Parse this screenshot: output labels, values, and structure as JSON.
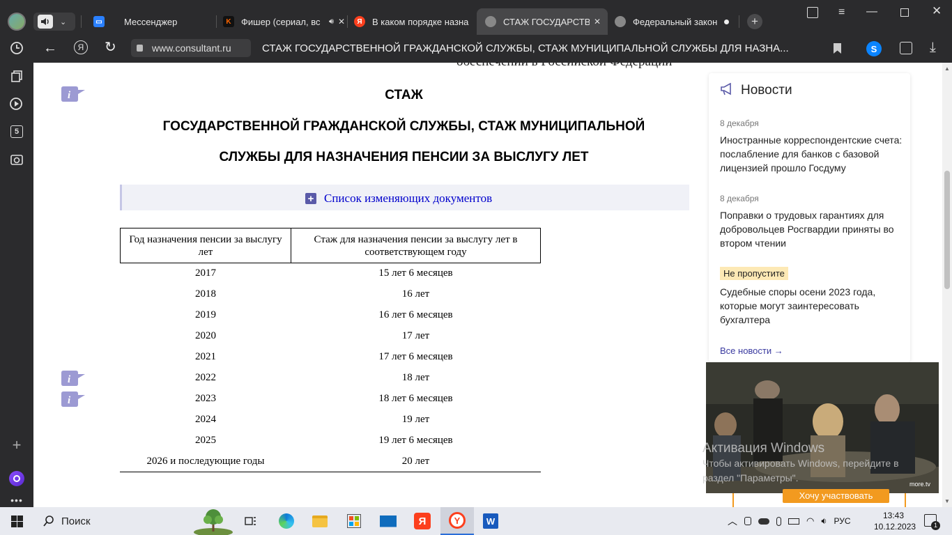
{
  "browser": {
    "tabs": [
      {
        "label": "Мессенджер"
      },
      {
        "label": "Фишер (сериал, вс"
      },
      {
        "label": "В каком порядке назна"
      },
      {
        "label": "СТАЖ ГОСУДАРСТВЕН"
      },
      {
        "label": "Федеральный закон"
      }
    ],
    "url_domain": "www.consultant.ru",
    "page_title": "СТАЖ ГОСУДАРСТВЕННОЙ ГРАЖДАНСКОЙ СЛУЖБЫ, СТАЖ МУНИЦИПАЛЬНОЙ СЛУЖБЫ ДЛЯ НАЗНА...",
    "sidebar_badge": "5"
  },
  "doc": {
    "top_fragment": "обеспечении в Российской Федерации",
    "title_line1": "СТАЖ",
    "title_line2": "ГОСУДАРСТВЕННОЙ ГРАЖДАНСКОЙ СЛУЖБЫ, СТАЖ МУНИЦИПАЛЬНОЙ",
    "title_line3": "СЛУЖБЫ ДЛЯ НАЗНАЧЕНИЯ ПЕНСИИ ЗА ВЫСЛУГУ ЛЕТ",
    "changes_link": "Список изменяющих документов",
    "table": {
      "headers": [
        "Год назначения пенсии за выслугу лет",
        "Стаж для назначения пенсии за выслугу лет в соответствующем году"
      ],
      "rows": [
        [
          "2017",
          "15 лет 6 месяцев"
        ],
        [
          "2018",
          "16 лет"
        ],
        [
          "2019",
          "16 лет 6 месяцев"
        ],
        [
          "2020",
          "17 лет"
        ],
        [
          "2021",
          "17 лет 6 месяцев"
        ],
        [
          "2022",
          "18 лет"
        ],
        [
          "2023",
          "18 лет 6 месяцев"
        ],
        [
          "2024",
          "19 лет"
        ],
        [
          "2025",
          "19 лет 6 месяцев"
        ],
        [
          "2026 и последующие годы",
          "20 лет"
        ]
      ]
    }
  },
  "news": {
    "title": "Новости",
    "items": [
      {
        "date": "8 декабря",
        "text": "Иностранные корреспондентские счета: послабление для банков с базовой лицензией прошло Госдуму"
      },
      {
        "date": "8 декабря",
        "text": "Поправки о трудовых гарантиях для добровольцев Росгвардии приняты во втором чтении"
      }
    ],
    "badge": "Не пропустите",
    "promo_text": "Судебные споры осени 2023 года, которые могут заинтересовать бухгалтера",
    "all_link": "Все новости →"
  },
  "video": {
    "watermark": "more.tv",
    "cta": "Хочу участвовать"
  },
  "activation": {
    "title": "Активация Windows",
    "line1": "Чтобы активировать Windows, перейдите в",
    "line2": "раздел \"Параметры\"."
  },
  "taskbar": {
    "search": "Поиск",
    "lang": "РУС",
    "time": "13:43",
    "date": "10.12.2023",
    "notif": "1"
  },
  "colors": {
    "link": "#0000cc",
    "accent": "#5a5aa8",
    "chrome": "#2b2b2d",
    "badge_bg": "#fde9b5",
    "cta": "#f29a1f"
  }
}
